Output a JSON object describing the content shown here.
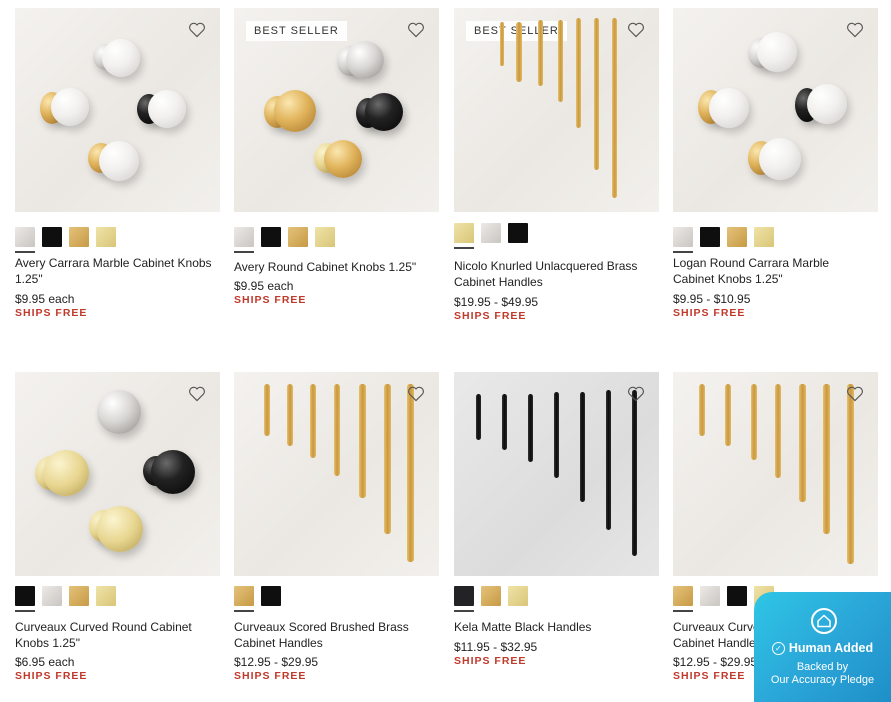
{
  "products": [
    {
      "name": "Avery Carrara Marble Cabinet Knobs 1.25\"",
      "price": "$9.95 each",
      "shipping": "SHIPS FREE",
      "badge": ""
    },
    {
      "name": "Avery Round Cabinet Knobs 1.25\"",
      "price": "$9.95 each",
      "shipping": "SHIPS FREE",
      "badge": "BEST SELLER"
    },
    {
      "name": "Nicolo Knurled Unlacquered Brass Cabinet Handles",
      "price": "$19.95 - $49.95",
      "shipping": "SHIPS FREE",
      "badge": "BEST SELLER"
    },
    {
      "name": "Logan Round Carrara Marble Cabinet Knobs 1.25\"",
      "price": "$9.95 - $10.95",
      "shipping": "SHIPS FREE",
      "badge": ""
    },
    {
      "name": "Curveaux Curved Round Cabinet Knobs 1.25\"",
      "price": "$6.95 each",
      "shipping": "SHIPS FREE",
      "badge": ""
    },
    {
      "name": "Curveaux Scored Brushed Brass Cabinet Handles",
      "price": "$12.95 - $29.95",
      "shipping": "SHIPS FREE",
      "badge": ""
    },
    {
      "name": "Kela Matte Black Handles",
      "price": "$11.95 - $32.95",
      "shipping": "SHIPS FREE",
      "badge": ""
    },
    {
      "name": "Curveaux Curved Brushed Brass Cabinet Handles",
      "price": "$12.95 - $29.95",
      "shipping": "SHIPS FREE",
      "badge": ""
    }
  ],
  "icons": {
    "favorite": "heart-icon"
  },
  "pledge": {
    "title": "Human Added",
    "line1": "Backed by",
    "line2": "Our Accuracy Pledge",
    "colors": {
      "start": "#2fc6e6",
      "end": "#1e8fc8"
    }
  },
  "colors": {
    "ships_free": "#c0392b",
    "text": "#222222"
  }
}
